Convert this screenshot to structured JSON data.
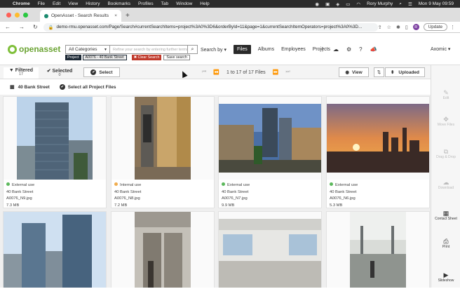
{
  "menubar": {
    "app": "Chrome",
    "items": [
      "File",
      "Edit",
      "View",
      "History",
      "Bookmarks",
      "Profiles",
      "Tab",
      "Window",
      "Help"
    ],
    "user": "Rory Murphy",
    "clock": "Mon 9 May 09:59"
  },
  "browser": {
    "tab_title": "OpenAsset - Search Results",
    "url": "demo-rmu.openasset.com/Page/Search#currentSearchItems=project%3A0%3D6&orderById=11&page=1&currentSearchItemOperators=project%3A0%3D...",
    "update_label": "Update",
    "profile_initial": "R"
  },
  "header": {
    "logo_text": "openasset",
    "category": "All Categories",
    "search_placeholder": "Refine your search by entering further terms",
    "chip_type": "Project",
    "chip_value": "A0076 - 40 Bank Street",
    "clear_label": "✖ Clear Search",
    "save_label": "Save search",
    "search_by": "Search by ▾",
    "nav": [
      "Files",
      "Albums",
      "Employees",
      "Projects"
    ],
    "org": "Axomic ▾"
  },
  "toolbar": {
    "filtered_label": "Filtered",
    "filtered_count": "17",
    "selected_label": "Selected",
    "selected_count": "0",
    "select_label": "Select",
    "pager_label": "1 to 17 of 17 Files",
    "view_label": "View",
    "sort_label": "Uploaded"
  },
  "project_bar": {
    "name": "40 Bank Street",
    "select_all": "Select all Project Files"
  },
  "cards": [
    {
      "status": "External use",
      "project": "40 Bank Street",
      "file": "A0076_N9.jpg",
      "size": "7.3 MB",
      "dot": "#5cb85c"
    },
    {
      "status": "Internal use",
      "project": "40 Bank Street",
      "file": "A0076_N8.jpg",
      "size": "7.2 MB",
      "dot": "#f0ad4e"
    },
    {
      "status": "External use",
      "project": "40 Bank Street",
      "file": "A0076_N7.jpg",
      "size": "9.9 MB",
      "dot": "#5cb85c"
    },
    {
      "status": "External use",
      "project": "40 Bank Street",
      "file": "A0076_N6.jpg",
      "size": "5.3 MB",
      "dot": "#5cb85c"
    }
  ],
  "sidebar": {
    "edit": "Edit",
    "move": "Move Files",
    "drag": "Drag & Drop",
    "download": "Download",
    "contact": "Contact Sheet",
    "print": "Print",
    "slideshow": "Slideshow"
  }
}
